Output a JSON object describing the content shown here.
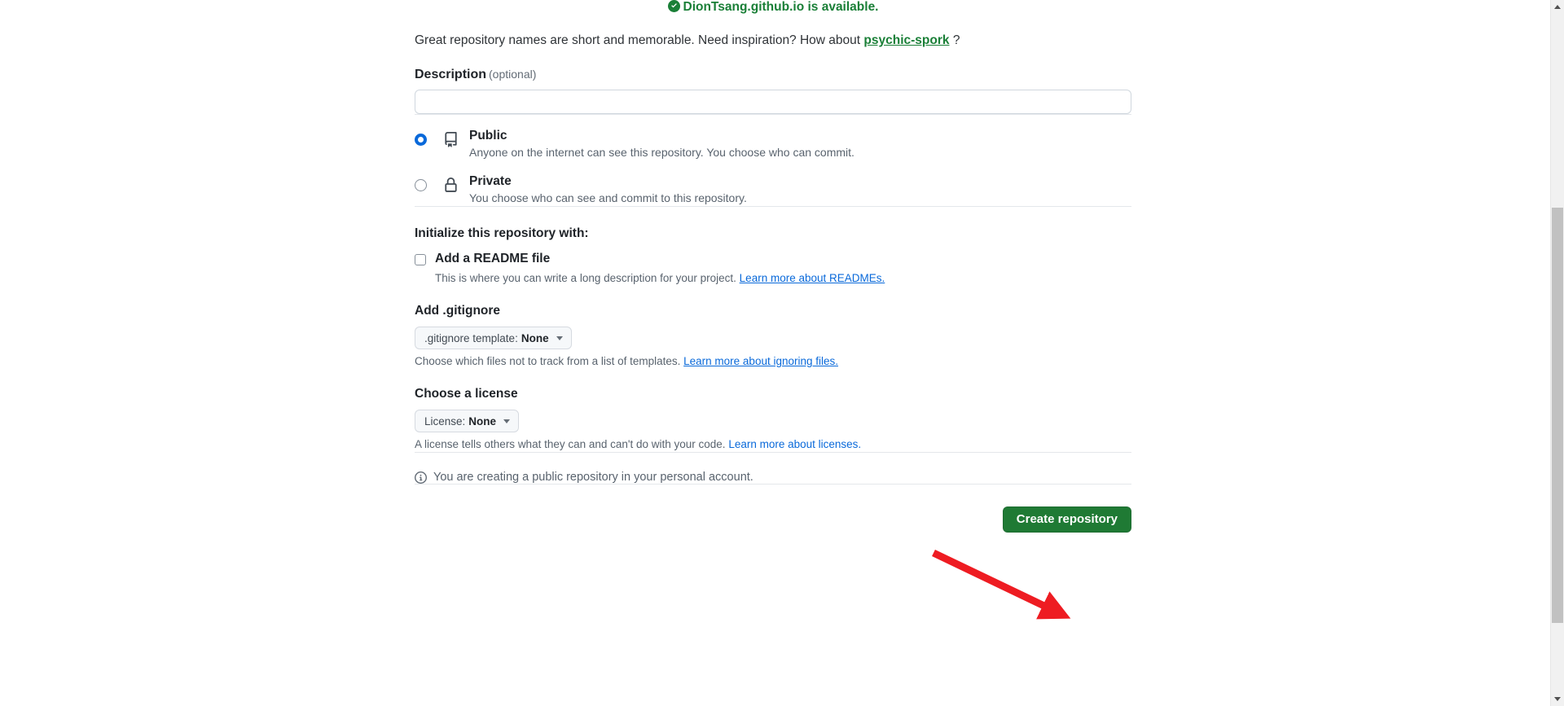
{
  "availability": {
    "icon": "check-circle-icon",
    "message": "DionTsang.github.io is available."
  },
  "inspiration": {
    "text_before": "Great repository names are short and memorable. Need inspiration? How about ",
    "suggestion": "psychic-spork",
    "text_after": "?"
  },
  "description": {
    "label": "Description",
    "optional_tag": "(optional)",
    "value": "",
    "placeholder": ""
  },
  "visibility": {
    "options": [
      {
        "id": "public",
        "icon": "repo-icon",
        "title": "Public",
        "subtitle": "Anyone on the internet can see this repository. You choose who can commit.",
        "selected": true
      },
      {
        "id": "private",
        "icon": "lock-icon",
        "title": "Private",
        "subtitle": "You choose who can see and commit to this repository.",
        "selected": false
      }
    ]
  },
  "initialize": {
    "heading": "Initialize this repository with:",
    "readme": {
      "label": "Add a README file",
      "checked": false,
      "helper_text": "This is where you can write a long description for your project. ",
      "helper_link": "Learn more about READMEs."
    }
  },
  "gitignore": {
    "heading": "Add .gitignore",
    "dropdown_prefix": ".gitignore template:",
    "dropdown_value": "None",
    "helper_text": "Choose which files not to track from a list of templates. ",
    "helper_link": "Learn more about ignoring files."
  },
  "license": {
    "heading": "Choose a license",
    "dropdown_prefix": "License:",
    "dropdown_value": "None",
    "helper_text": "A license tells others what they can and can't do with your code. ",
    "helper_link": "Learn more about licenses."
  },
  "notice": {
    "icon": "info-icon",
    "text": "You are creating a public repository in your personal account."
  },
  "submit": {
    "label": "Create repository"
  },
  "annotation": {
    "type": "arrow",
    "color": "#ee1c22"
  },
  "colors": {
    "success_green": "#1a7f37",
    "button_green": "#1f7a34",
    "link_blue": "#0969da",
    "radio_blue": "#0969da",
    "muted_text": "#59636e",
    "border": "#d0d7de",
    "annotation_red": "#ee1c22"
  }
}
